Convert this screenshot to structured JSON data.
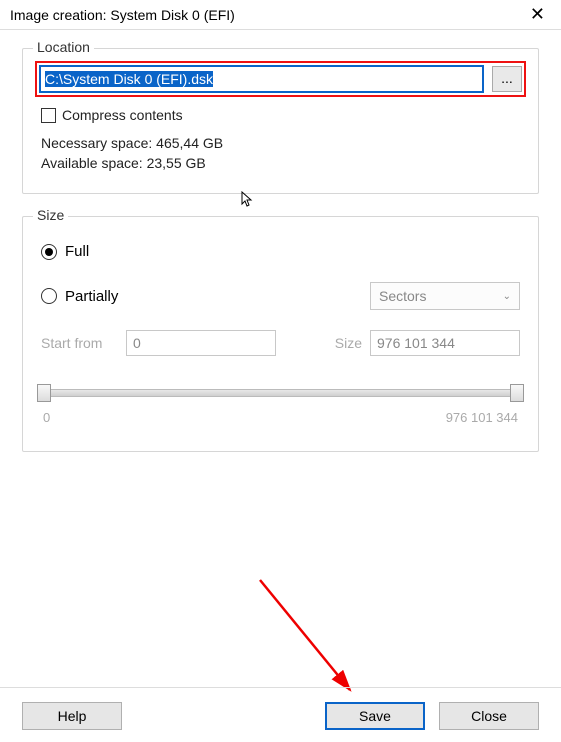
{
  "titlebar": {
    "title": "Image creation: System Disk 0 (EFI)"
  },
  "location": {
    "group_label": "Location",
    "path": "C:\\System Disk 0 (EFI).dsk",
    "browse_label": "...",
    "compress_label": "Compress contents",
    "compress_checked": false,
    "necessary_space": "Necessary space: 465,44 GB",
    "available_space": "Available space: 23,55 GB"
  },
  "size": {
    "group_label": "Size",
    "full_label": "Full",
    "partially_label": "Partially",
    "selected": "full",
    "units_selected": "Sectors",
    "start_from_label": "Start from",
    "start_from_value": "0",
    "size_label": "Size",
    "size_value": "976 101 344",
    "slider_min": "0",
    "slider_max": "976 101 344"
  },
  "buttons": {
    "help": "Help",
    "save": "Save",
    "close": "Close"
  }
}
